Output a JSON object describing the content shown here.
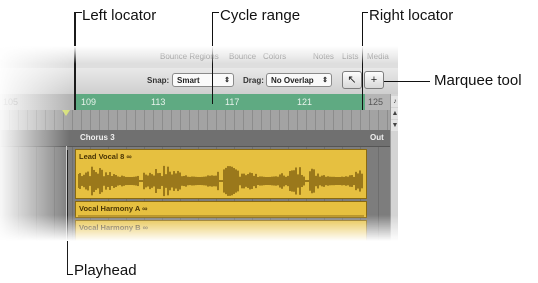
{
  "callouts": {
    "left_locator": "Left locator",
    "cycle_range": "Cycle range",
    "right_locator": "Right locator",
    "marquee_tool": "Marquee tool",
    "playhead": "Playhead"
  },
  "topmenu": [
    "Bounce Regions",
    "Bounce",
    "Colors",
    "Notes",
    "Lists",
    "Media"
  ],
  "toolbar": {
    "snap_label": "Snap:",
    "snap_value": "Smart",
    "drag_label": "Drag:",
    "drag_value": "No Overlap",
    "pointer_tool_glyph": "↖",
    "marquee_tool_glyph": "+"
  },
  "ruler": {
    "bars": [
      "105",
      "109",
      "113",
      "117",
      "121",
      "125"
    ]
  },
  "marker_lane": {
    "marker": "Chorus 3",
    "out_label": "Out"
  },
  "regions": [
    {
      "name": "Lead Vocal 8",
      "loop_glyph": "∞"
    },
    {
      "name": "Vocal Harmony A",
      "loop_glyph": "∞"
    },
    {
      "name": "Vocal Harmony B",
      "loop_glyph": "∞"
    }
  ],
  "colors": {
    "cycle": "#5faa82",
    "region": "#e6c040"
  },
  "icons": [
    "arrow-pointer-icon",
    "crosshair-icon",
    "note-icon",
    "scroll-up-icon",
    "scroll-down-icon"
  ]
}
